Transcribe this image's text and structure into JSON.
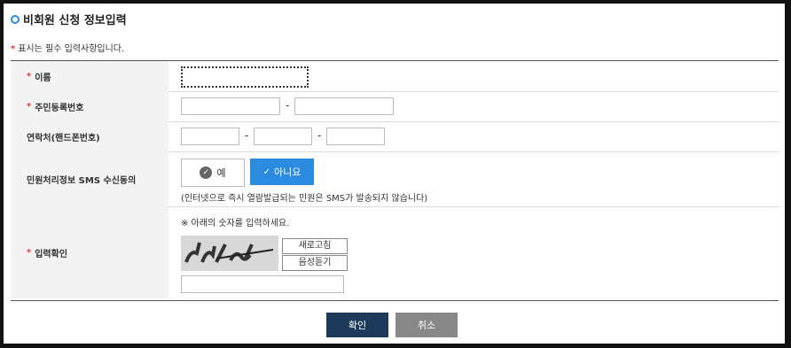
{
  "header": {
    "title": "비회원 신청 정보입력",
    "required_note": "표시는 필수 입력사항입니다."
  },
  "form": {
    "name_label": "이름",
    "rrn_label": "주민등록번호",
    "phone_label": "연락처(핸드폰번호)",
    "sms_label": "민원처리정보 SMS 수신동의",
    "sms_yes": "예",
    "sms_no": "아니요",
    "sms_hint": "(인터넷으로 즉시 열람발급되는 민원은 SMS가 발송되지 않습니다)",
    "captcha_label": "입력확인",
    "captcha_note": "※ 아래의 숫자를 입력하세요.",
    "captcha_refresh": "새로고침",
    "captcha_audio": "음성듣기"
  },
  "actions": {
    "confirm": "확인",
    "cancel": "취소"
  },
  "colors": {
    "accent": "#2a8be0",
    "primary": "#1d3a5a",
    "required": "#e23b3b"
  }
}
